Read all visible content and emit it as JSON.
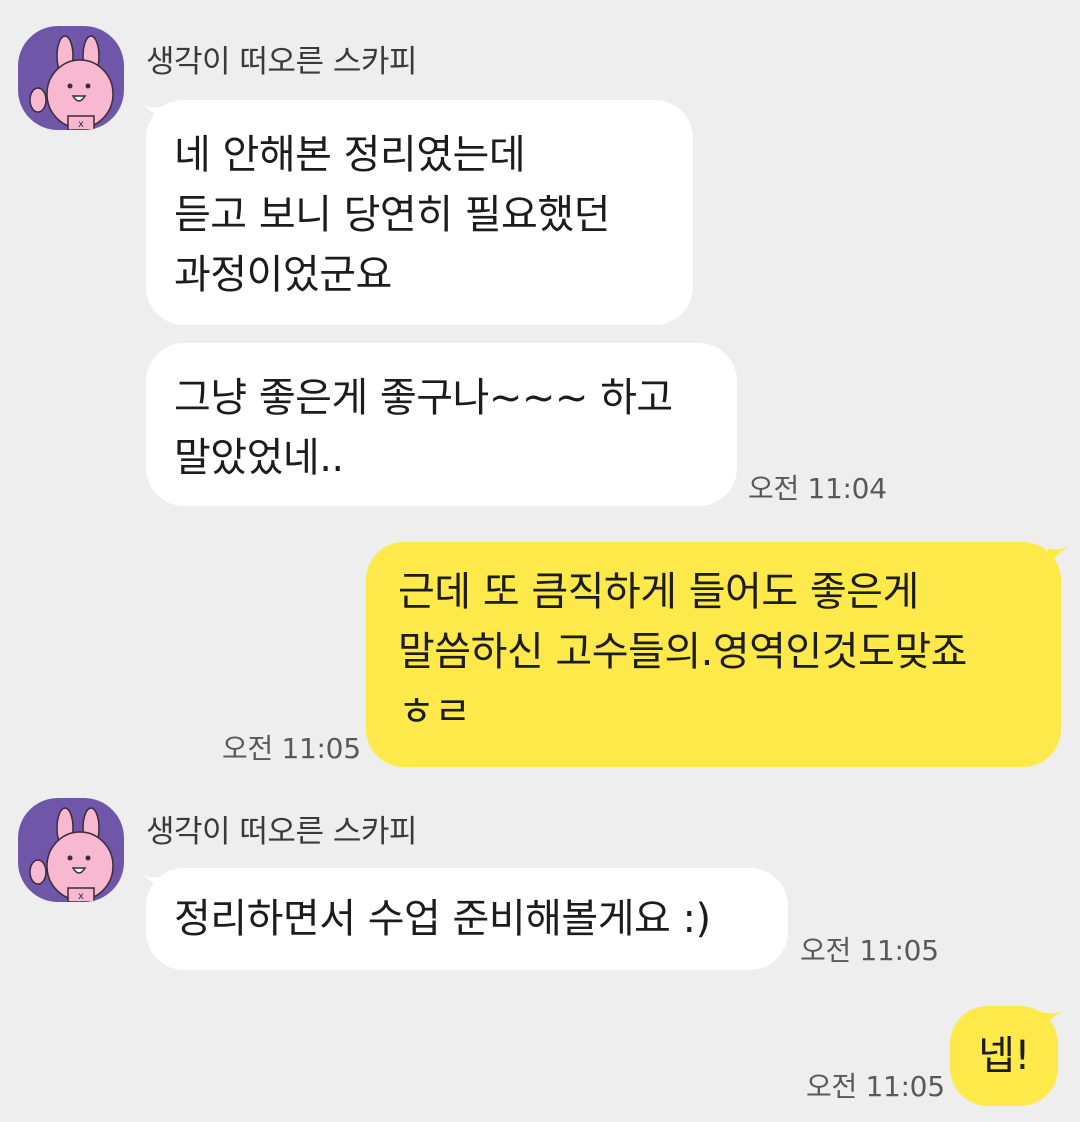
{
  "colors": {
    "background": "#eeeeee",
    "incoming_bubble": "#ffffff",
    "outgoing_bubble": "#fde94a",
    "avatar_bg": "#6f56a8"
  },
  "messages": {
    "group1": {
      "sender": "생각이 떠오른 스카피",
      "avatar_icon": "rabbit-avatar-icon",
      "bubble1": "네 안해본 정리였는데\n듣고 보니 당연히 필요했던\n과정이었군요",
      "bubble2": "그냥 좋은게 좋구나~~~ 하고\n말았었네..",
      "time": "오전 11:04"
    },
    "outgoing1": {
      "text": "근데 또 큼직하게 들어도 좋은게\n말씀하신 고수들의.영역인것도맞죠\nㅎㄹ",
      "time": "오전 11:05"
    },
    "group2": {
      "sender": "생각이 떠오른 스카피",
      "avatar_icon": "rabbit-avatar-icon",
      "bubble1": "정리하면서 수업 준비해볼게요 :)",
      "time": "오전 11:05"
    },
    "outgoing2": {
      "text": "넵!",
      "time": "오전 11:05"
    }
  }
}
